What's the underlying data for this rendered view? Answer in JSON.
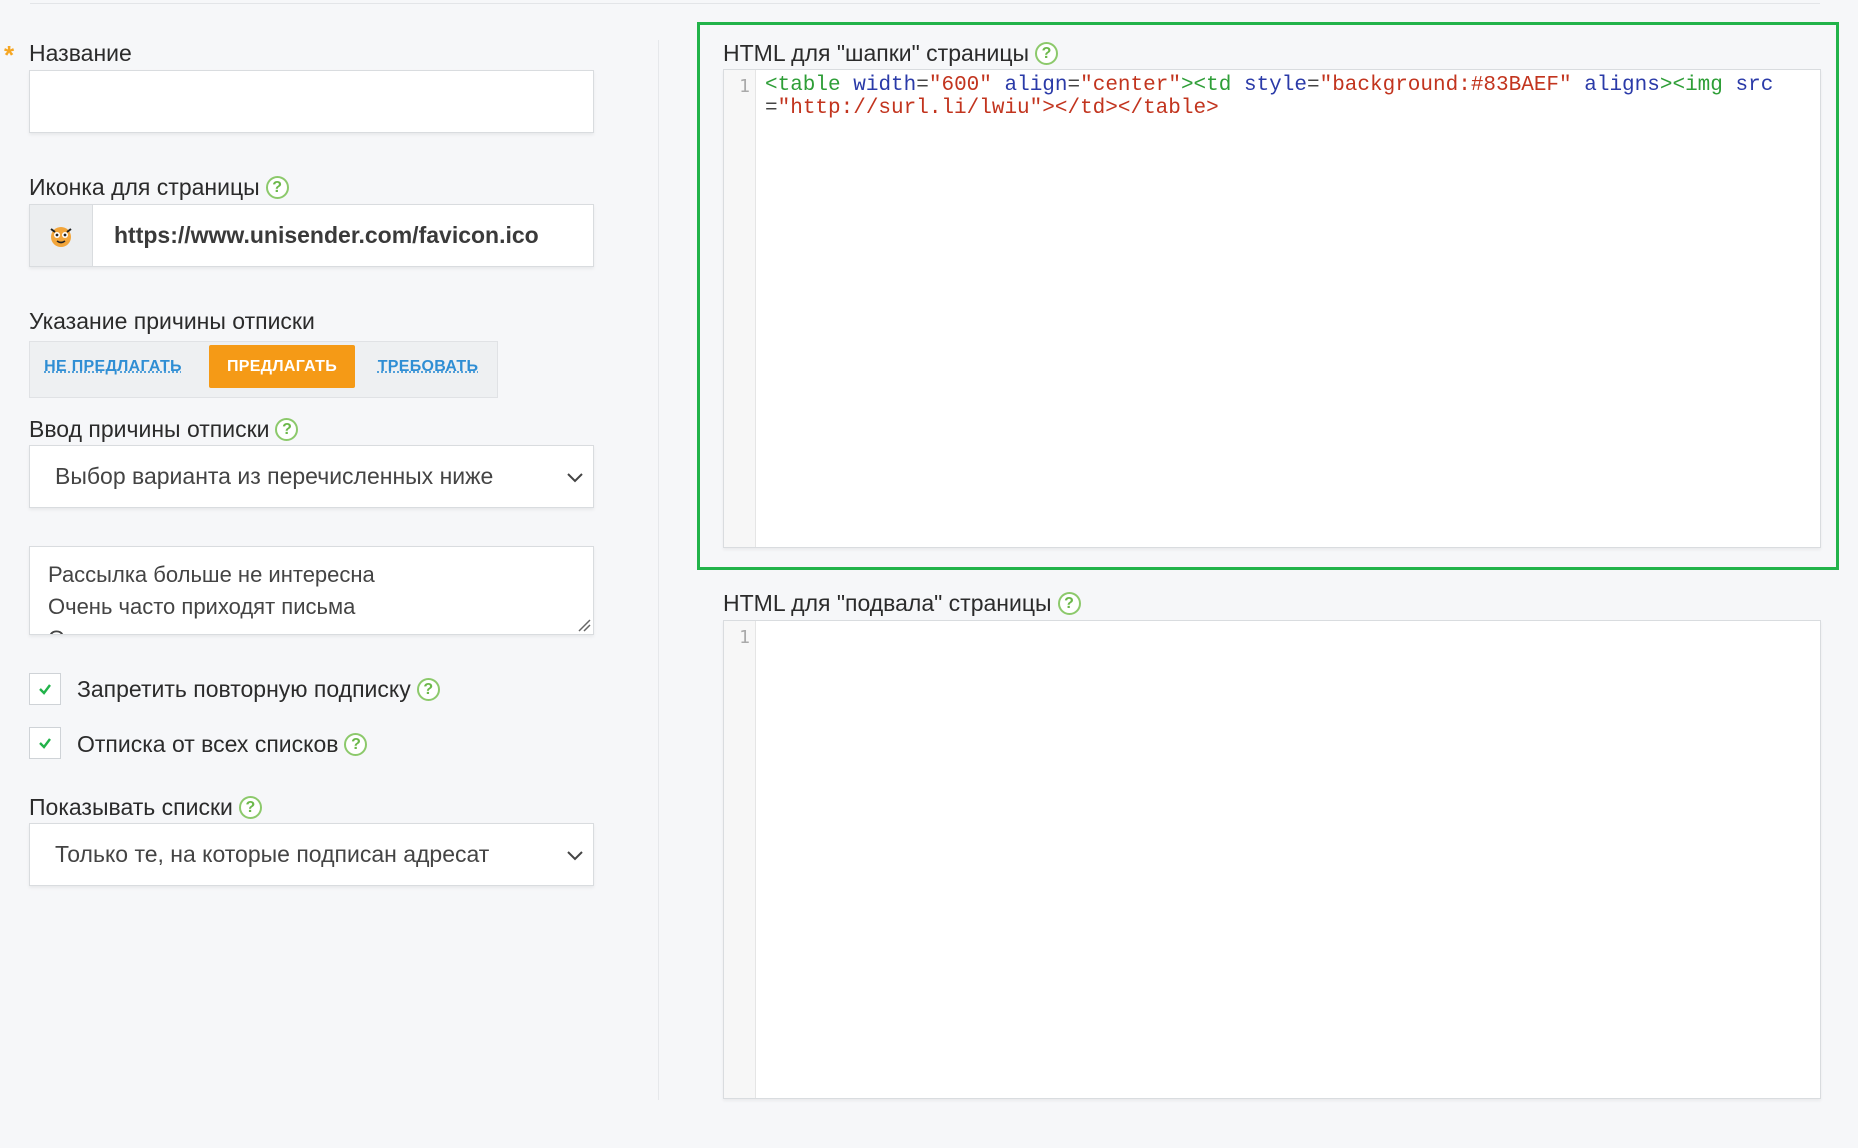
{
  "left": {
    "name_label": "Название",
    "icon_label": "Иконка для страницы",
    "icon_url": "https://www.unisender.com/favicon.ico",
    "reason_label": "Указание причины отписки",
    "reason_options": [
      "НЕ ПРЕДЛАГАТЬ",
      "ПРЕДЛАГАТЬ",
      "ТРЕБОВАТЬ"
    ],
    "reason_selected": "ПРЕДЛАГАТЬ",
    "reason_input_label": "Ввод причины отписки",
    "reason_input_value": "Выбор варианта из перечисленных ниже",
    "reason_list": [
      "Рассылка больше не интересна",
      "Очень часто приходят письма",
      "Огромное количество рассылок и писем"
    ],
    "forbid_resubscribe_label": "Запретить повторную подписку",
    "forbid_resubscribe_checked": true,
    "unsubscribe_all_label": "Отписка от всех списков",
    "unsubscribe_all_checked": true,
    "show_lists_label": "Показывать списки",
    "show_lists_value": "Только те, на которые подписан адресат"
  },
  "right": {
    "header_label": "HTML для \"шапки\" страницы",
    "header_code": "<table width=\"600\" align=\"center\"><td style=\"background:#83BAEF\" aligns><img src=\"http://surl.li/lwiu\"></td></table>",
    "header_code_tokens": [
      {
        "t": "tag",
        "v": "<table"
      },
      {
        "t": "punc",
        "v": " "
      },
      {
        "t": "attr",
        "v": "width"
      },
      {
        "t": "punc",
        "v": "="
      },
      {
        "t": "str",
        "v": "\"600\""
      },
      {
        "t": "punc",
        "v": " "
      },
      {
        "t": "attr",
        "v": "align"
      },
      {
        "t": "punc",
        "v": "="
      },
      {
        "t": "str",
        "v": "\"center\""
      },
      {
        "t": "tag",
        "v": ">"
      },
      {
        "t": "tag",
        "v": "<td"
      },
      {
        "t": "punc",
        "v": " "
      },
      {
        "t": "attr",
        "v": "style"
      },
      {
        "t": "punc",
        "v": "="
      },
      {
        "t": "str",
        "v": "\"background:#83BAEF\""
      },
      {
        "t": "punc",
        "v": " "
      },
      {
        "t": "attr",
        "v": "aligns"
      },
      {
        "t": "tag",
        "v": "><img"
      },
      {
        "t": "punc",
        "v": " "
      },
      {
        "t": "attr",
        "v": "src"
      },
      {
        "t": "punc",
        "v": "="
      },
      {
        "t": "str",
        "v": "\"http://surl.li/lwiu\""
      },
      {
        "t": "str",
        "v": "></td></table>"
      }
    ],
    "header_line_number": "1",
    "footer_label": "HTML для \"подвала\" страницы",
    "footer_line_number": "1"
  },
  "colors": {
    "accent": "#f59a16",
    "link": "#2f8ed4",
    "help": "#6bb84a",
    "highlight_frame": "#22b34a"
  },
  "icons": {
    "help": "question-circle-icon",
    "select_arrow": "chevron-down-icon",
    "checkbox": "checkmark-icon",
    "favicon": "unisender-monkey-icon"
  }
}
